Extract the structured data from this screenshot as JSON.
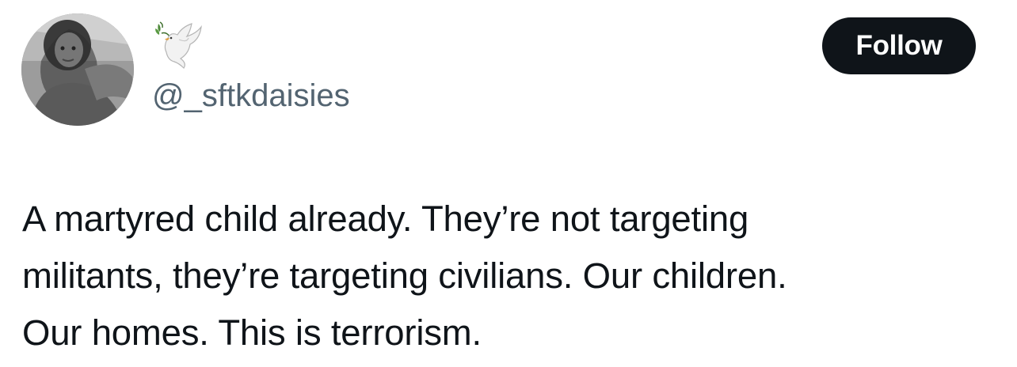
{
  "author": {
    "display_name_icon": "dove-with-olive-branch-emoji",
    "handle": "@_sftkdaisies",
    "avatar_icon": "profile-photo"
  },
  "follow_button": {
    "label": "Follow"
  },
  "tweet": {
    "lines": [
      "A martyred child already. They’re not targeting",
      "militants, they’re targeting civilians. Our children.",
      "Our homes. This is terrorism."
    ]
  },
  "colors": {
    "text_primary": "#0f1419",
    "text_secondary": "#536471",
    "button_bg": "#0f1419",
    "button_text": "#ffffff",
    "background": "#ffffff"
  }
}
